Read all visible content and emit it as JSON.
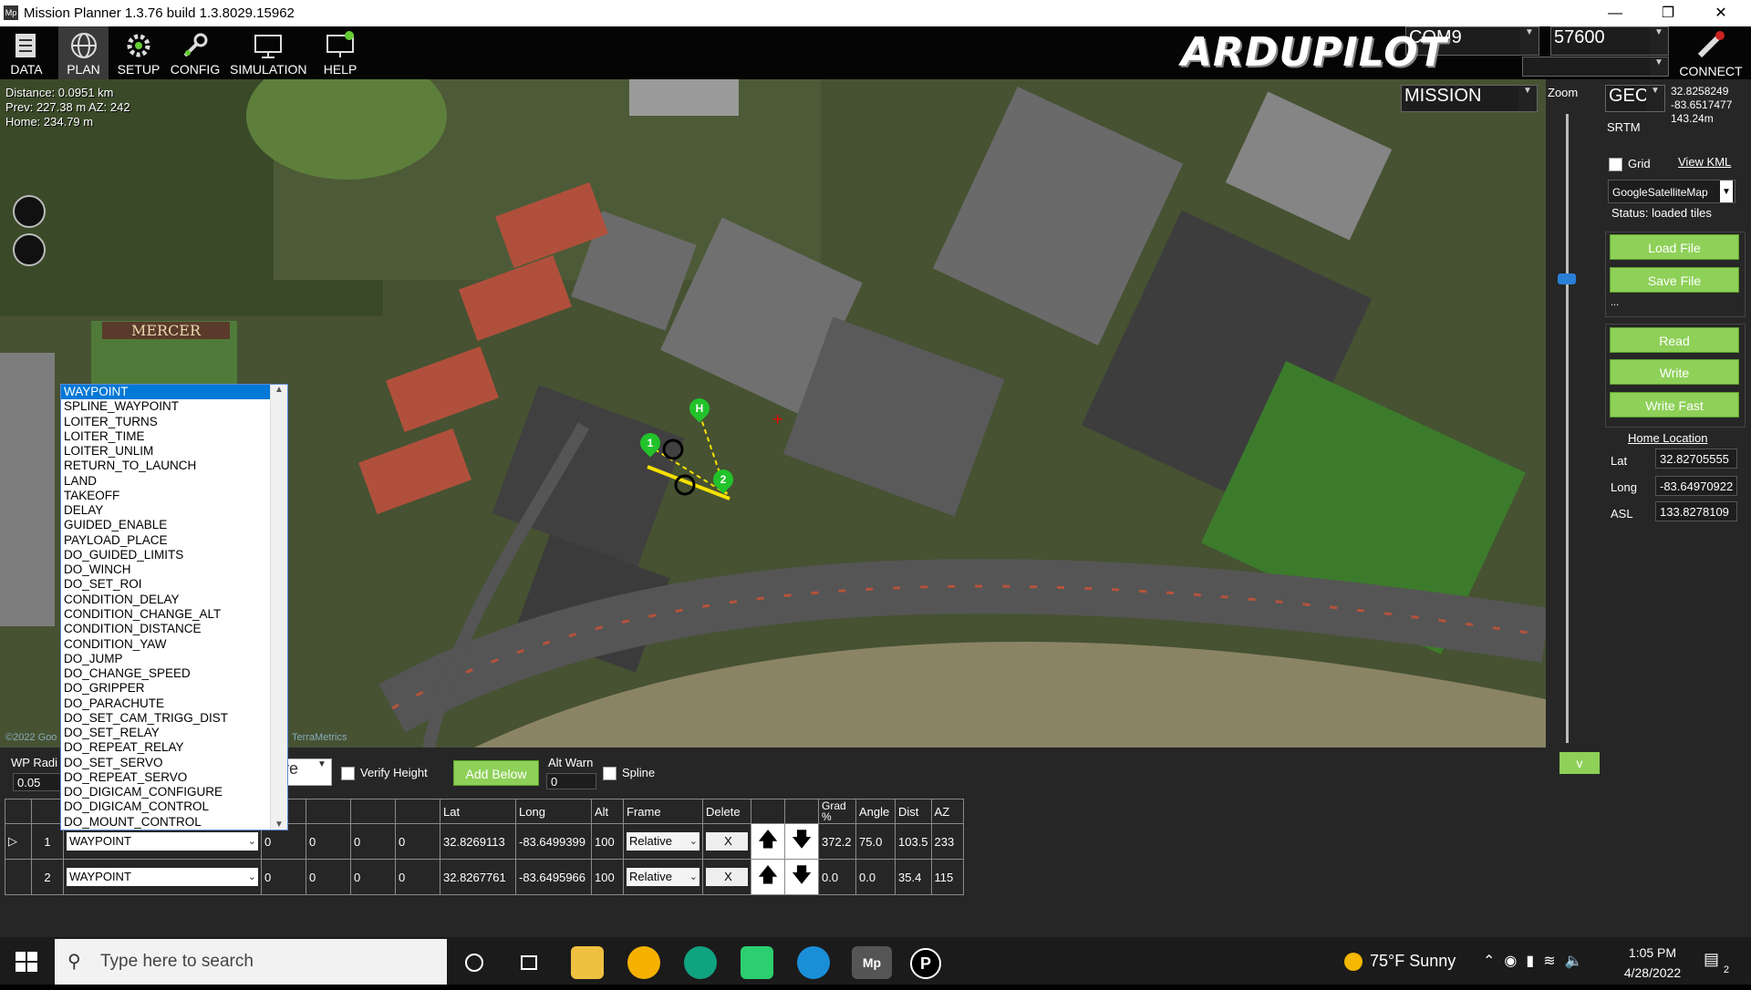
{
  "window": {
    "title": "Mission Planner 1.3.76 build 1.3.8029.15962",
    "app_icon": "Mp"
  },
  "toolbar": {
    "buttons": [
      {
        "label": "DATA",
        "icon": "data-icon"
      },
      {
        "label": "PLAN",
        "icon": "plan-globe-icon"
      },
      {
        "label": "SETUP",
        "icon": "setup-gear-icon"
      },
      {
        "label": "CONFIG",
        "icon": "config-wrench-icon"
      },
      {
        "label": "SIMULATION",
        "icon": "simulation-monitor-icon"
      },
      {
        "label": "HELP",
        "icon": "help-monitor-icon"
      }
    ],
    "active": "PLAN",
    "logo": "ARDUPILOT",
    "port": "COM9",
    "baud": "57600",
    "connect_label": "CONNECT"
  },
  "map": {
    "info": {
      "distance": "Distance: 0.0951 km",
      "prev": "Prev: 227.38 m AZ: 242",
      "home": "Home: 234.79 m"
    },
    "mode": "MISSION",
    "zoom_label": "Zoom",
    "coord_format": "GEC",
    "srtm_label": "SRTM",
    "cursor_lat": "32.8258249",
    "cursor_lng": "-83.6517477",
    "cursor_alt": "143.24m",
    "field_text": "MERCER",
    "markers": [
      {
        "label": "H"
      },
      {
        "label": "1"
      },
      {
        "label": "2"
      }
    ],
    "attribution_left": "©2022 Goo",
    "attribution_right": "TerraMetrics"
  },
  "right": {
    "grid_label": "Grid",
    "view_kml": "View KML",
    "provider": "GoogleSatelliteMap",
    "status": "Status: loaded tiles",
    "load_file": "Load File",
    "save_file": "Save File",
    "dots": "...",
    "read": "Read",
    "write": "Write",
    "write_fast": "Write Fast",
    "home_location": "Home Location",
    "lat_label": "Lat",
    "lat": "32.82705555",
    "long_label": "Long",
    "long": "-83.64970922",
    "asl_label": "ASL",
    "asl": "133.8278109",
    "collapse": "v"
  },
  "bottom": {
    "wp_radius_label": "WP Radi",
    "wp_radius": "0.05",
    "alt_mode": "ive",
    "verify_height": "Verify Height",
    "add_below": "Add Below",
    "alt_warn_label": "Alt Warn",
    "alt_warn": "0",
    "spline": "Spline"
  },
  "table": {
    "headers": [
      "",
      "",
      "",
      "y",
      "",
      "",
      "",
      "Lat",
      "Long",
      "Alt",
      "Frame",
      "Delete",
      "",
      "",
      "Grad %",
      "Angle",
      "Dist",
      "AZ"
    ],
    "rows": [
      {
        "num": "1",
        "cmd": "WAYPOINT",
        "p1": "0",
        "p2": "0",
        "p3": "0",
        "p4": "0",
        "lat": "32.8269113",
        "long": "-83.6499399",
        "alt": "100",
        "frame": "Relative",
        "del": "X",
        "grad": "372.2",
        "angle": "75.0",
        "dist": "103.5",
        "az": "233"
      },
      {
        "num": "2",
        "cmd": "WAYPOINT",
        "p1": "0",
        "p2": "0",
        "p3": "0",
        "p4": "0",
        "lat": "32.8267761",
        "long": "-83.6495966",
        "alt": "100",
        "frame": "Relative",
        "del": "X",
        "grad": "0.0",
        "angle": "0.0",
        "dist": "35.4",
        "az": "115"
      }
    ]
  },
  "dropdown": {
    "items": [
      "WAYPOINT",
      "SPLINE_WAYPOINT",
      "LOITER_TURNS",
      "LOITER_TIME",
      "LOITER_UNLIM",
      "RETURN_TO_LAUNCH",
      "LAND",
      "TAKEOFF",
      "DELAY",
      "GUIDED_ENABLE",
      "PAYLOAD_PLACE",
      "DO_GUIDED_LIMITS",
      "DO_WINCH",
      "DO_SET_ROI",
      "CONDITION_DELAY",
      "CONDITION_CHANGE_ALT",
      "CONDITION_DISTANCE",
      "CONDITION_YAW",
      "DO_JUMP",
      "DO_CHANGE_SPEED",
      "DO_GRIPPER",
      "DO_PARACHUTE",
      "DO_SET_CAM_TRIGG_DIST",
      "DO_SET_RELAY",
      "DO_REPEAT_RELAY",
      "DO_SET_SERVO",
      "DO_REPEAT_SERVO",
      "DO_DIGICAM_CONFIGURE",
      "DO_DIGICAM_CONTROL",
      "DO_MOUNT_CONTROL"
    ],
    "selected": "WAYPOINT"
  },
  "taskbar": {
    "search_placeholder": "Type here to search",
    "weather": "75°F  Sunny",
    "time": "1:05 PM",
    "date": "4/28/2022",
    "notifications": "2",
    "apps": [
      "cortana-icon",
      "taskview-icon",
      "file-explorer-icon",
      "chrome-icon",
      "chatgpt-icon",
      "pycharm-icon",
      "edge-icon",
      "mission-planner-icon",
      "p-app-icon"
    ]
  },
  "colors": {
    "accent_green": "#8ed058",
    "marker_green": "#22c22a",
    "path_yellow": "#f5e000",
    "select_blue": "#0078d7"
  }
}
